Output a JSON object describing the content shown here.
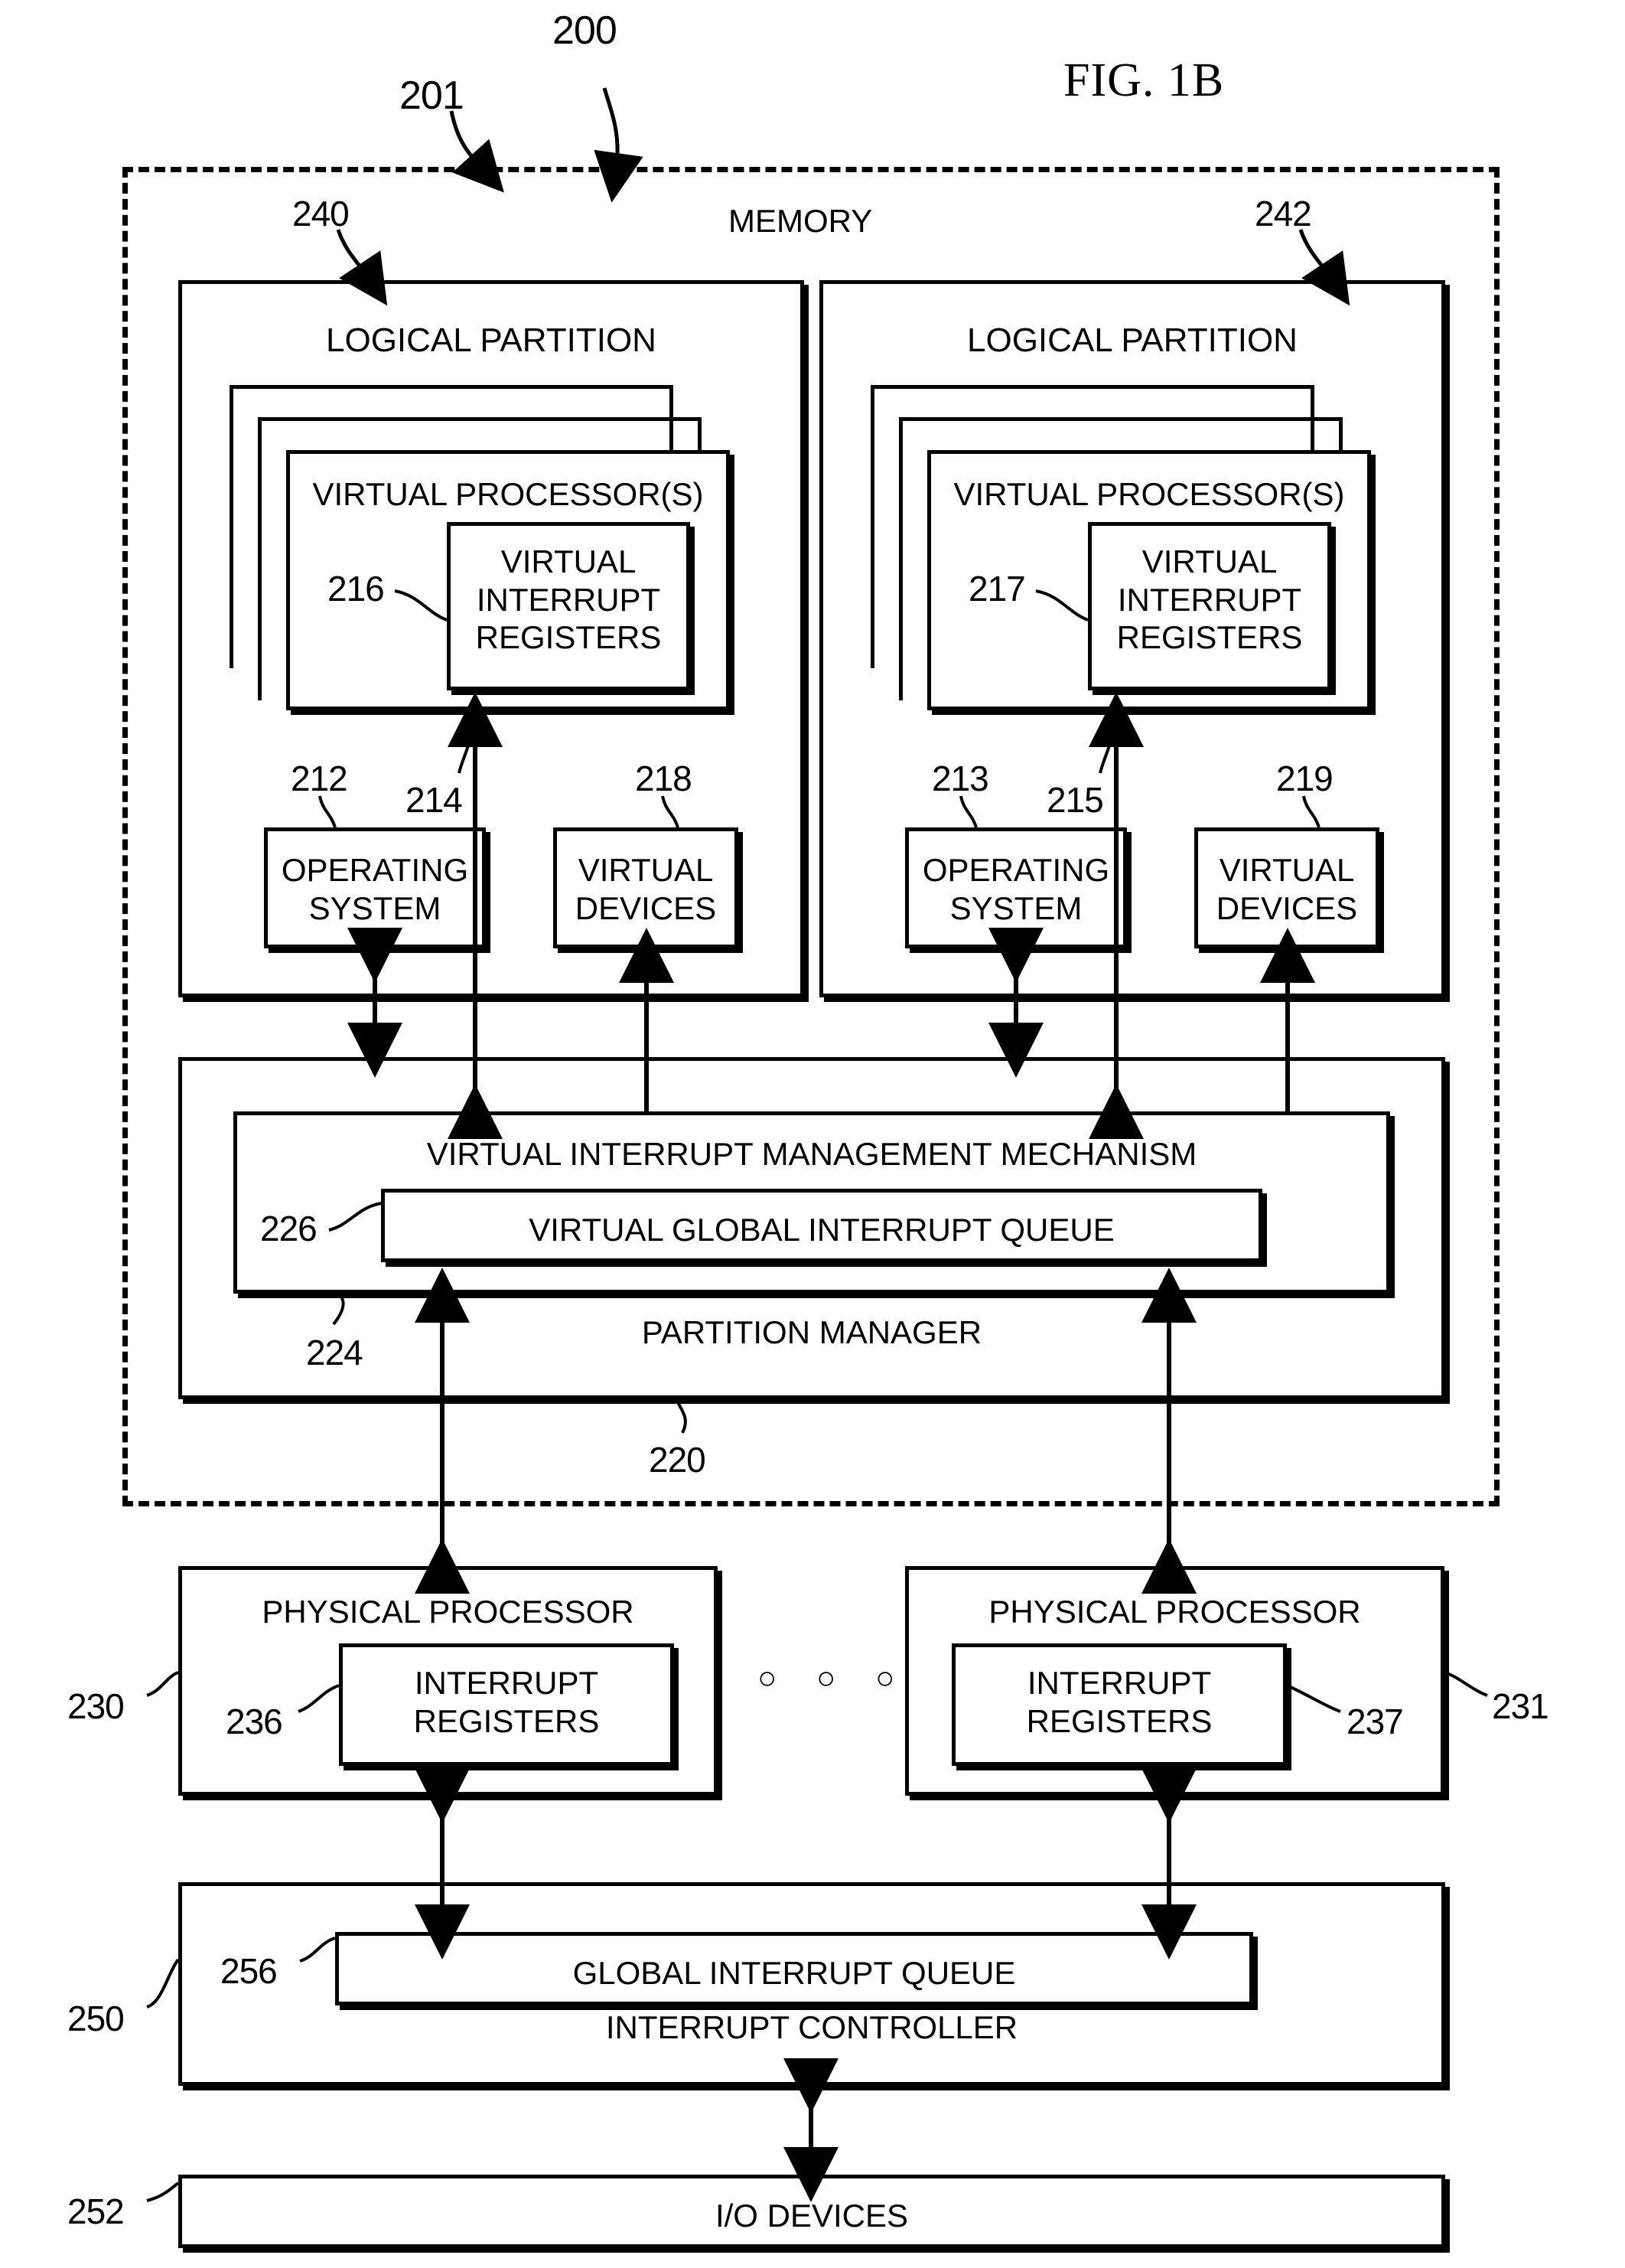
{
  "figure": {
    "title": "FIG. 1B",
    "system_ref": "200",
    "boundary_ref": "201",
    "memory_label": "MEMORY"
  },
  "partitions": [
    {
      "ref": "240",
      "label": "LOGICAL PARTITION",
      "virtual_processor": {
        "label": "VIRTUAL PROCESSOR(S)",
        "ref": "214"
      },
      "virtual_interrupt_registers": {
        "label": "VIRTUAL\nINTERRUPT\nREGISTERS",
        "ref": "216"
      },
      "operating_system": {
        "label": "OPERATING\nSYSTEM",
        "ref": "212"
      },
      "virtual_devices": {
        "label": "VIRTUAL\nDEVICES",
        "ref": "218"
      }
    },
    {
      "ref": "242",
      "label": "LOGICAL PARTITION",
      "virtual_processor": {
        "label": "VIRTUAL PROCESSOR(S)",
        "ref": "215"
      },
      "virtual_interrupt_registers": {
        "label": "VIRTUAL\nINTERRUPT\nREGISTERS",
        "ref": "217"
      },
      "operating_system": {
        "label": "OPERATING\nSYSTEM",
        "ref": "213"
      },
      "virtual_devices": {
        "label": "VIRTUAL\nDEVICES",
        "ref": "219"
      }
    }
  ],
  "partition_manager": {
    "label": "PARTITION MANAGER",
    "ref": "220",
    "mechanism": {
      "label": "VIRTUAL INTERRUPT MANAGEMENT MECHANISM",
      "ref": "224"
    },
    "queue": {
      "label": "VIRTUAL GLOBAL INTERRUPT QUEUE",
      "ref": "226"
    }
  },
  "physical_processors": [
    {
      "label": "PHYSICAL PROCESSOR",
      "ref": "230",
      "registers": {
        "label": "INTERRUPT\nREGISTERS",
        "ref": "236"
      }
    },
    {
      "label": "PHYSICAL PROCESSOR",
      "ref": "231",
      "registers": {
        "label": "INTERRUPT\nREGISTERS",
        "ref": "237"
      }
    }
  ],
  "ellipsis": "○ ○ ○",
  "interrupt_controller": {
    "label": "INTERRUPT CONTROLLER",
    "ref": "250",
    "queue": {
      "label": "GLOBAL  INTERRUPT QUEUE",
      "ref": "256"
    }
  },
  "io_devices": {
    "label": "I/O DEVICES",
    "ref": "252"
  },
  "colors": {
    "line": "#000000",
    "background": "#ffffff"
  }
}
